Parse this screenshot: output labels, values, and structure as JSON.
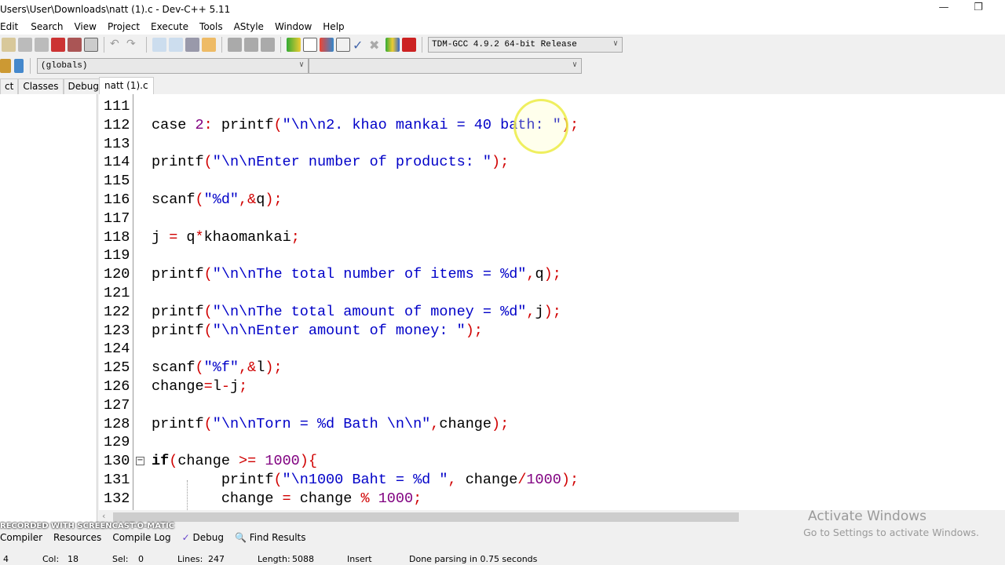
{
  "window": {
    "title": "Users\\User\\Downloads\\natt (1).c - Dev-C++ 5.11",
    "minimize": "—",
    "restore": "❐"
  },
  "menu": [
    "Edit",
    "Search",
    "View",
    "Project",
    "Execute",
    "Tools",
    "AStyle",
    "Window",
    "Help"
  ],
  "toolbar": {
    "compiler": "TDM-GCC 4.9.2 64-bit Release",
    "scope": "(globals)",
    "symbol": ""
  },
  "left_tabs": [
    "ct",
    "Classes",
    "Debug"
  ],
  "file_tab": "natt (1).c",
  "code_lines": [
    {
      "n": "111",
      "code": ""
    },
    {
      "n": "112",
      "code": "case 2: printf(\"\\n\\n2. khao mankai = 40 bath: \");"
    },
    {
      "n": "113",
      "code": ""
    },
    {
      "n": "114",
      "code": "printf(\"\\n\\nEnter number of products: \");"
    },
    {
      "n": "115",
      "code": ""
    },
    {
      "n": "116",
      "code": "scanf(\"%d\",&q);"
    },
    {
      "n": "117",
      "code": ""
    },
    {
      "n": "118",
      "code": "j = q*khaomankai;"
    },
    {
      "n": "119",
      "code": ""
    },
    {
      "n": "120",
      "code": "printf(\"\\n\\nThe total number of items = %d\",q);"
    },
    {
      "n": "121",
      "code": ""
    },
    {
      "n": "122",
      "code": "printf(\"\\n\\nThe total amount of money = %d\",j);"
    },
    {
      "n": "123",
      "code": "printf(\"\\n\\nEnter amount of money: \");"
    },
    {
      "n": "124",
      "code": ""
    },
    {
      "n": "125",
      "code": "scanf(\"%f\",&l);"
    },
    {
      "n": "126",
      "code": "change=l-j;"
    },
    {
      "n": "127",
      "code": ""
    },
    {
      "n": "128",
      "code": "printf(\"\\n\\nTorn = %d Bath \\n\\n\",change);"
    },
    {
      "n": "129",
      "code": ""
    },
    {
      "n": "130",
      "code": "if(change >= 1000){",
      "fold": "−"
    },
    {
      "n": "131",
      "code": "        printf(\"\\n1000 Baht = %d \", change/1000);"
    },
    {
      "n": "132",
      "code": "        change = change % 1000;"
    }
  ],
  "bottom_tabs": [
    "Compiler",
    "Resources",
    "Compile Log",
    "Debug",
    "Find Results"
  ],
  "status": {
    "line": "4",
    "col_label": "Col:",
    "col": "18",
    "sel_label": "Sel:",
    "sel": "0",
    "lines_label": "Lines:",
    "lines": "247",
    "length_label": "Length:",
    "length": "5088",
    "mode": "Insert",
    "message": "Done parsing in 0.75 seconds"
  },
  "watermark": {
    "line1": "Activate Windows",
    "line2": "Go to Settings to activate Windows."
  },
  "recorder": "RECORDED WITH SCREENCAST-O-MATIC",
  "colors": {
    "string": "#0000c8",
    "symbol": "#d00000",
    "number": "#800080"
  }
}
